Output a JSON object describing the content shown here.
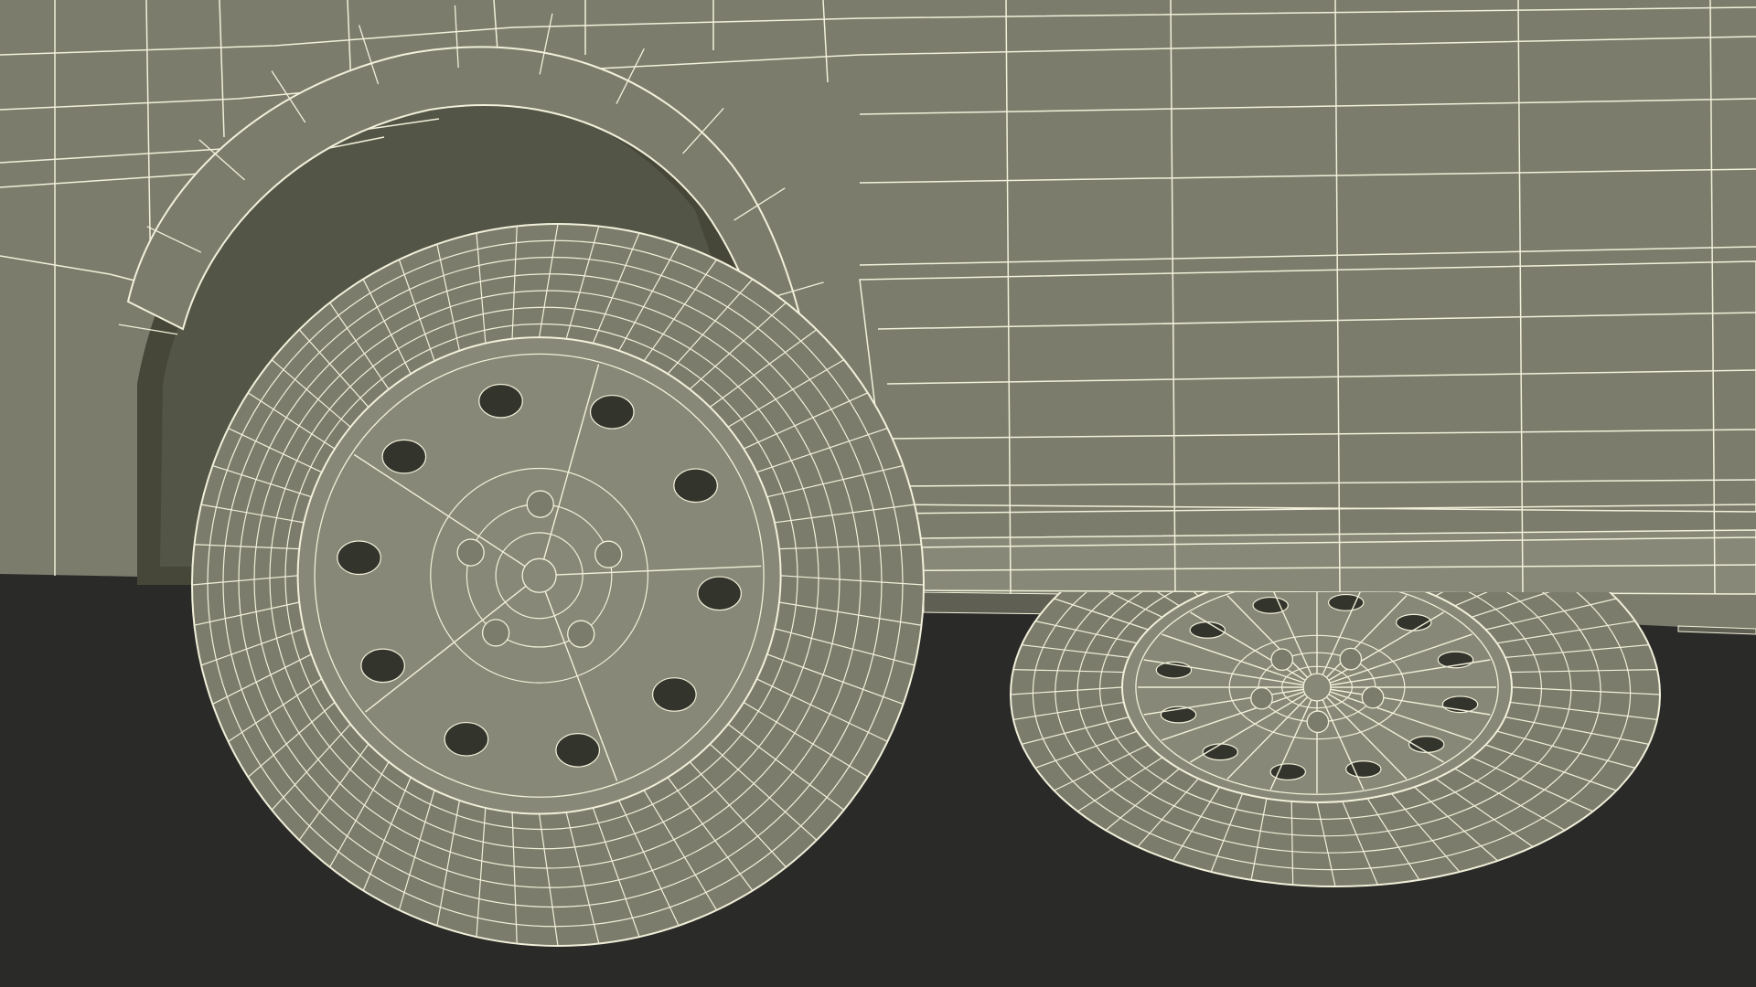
{
  "scene": {
    "subject": "car-wireframe-render",
    "colors": {
      "background": "#2a2a28",
      "surface": "#7b7c6c",
      "surface_dark": "#5f6053",
      "surface_light": "#878877",
      "wheel_well_inner": "#464739",
      "opening_dark": "#33342c",
      "wire": "#f2f0da"
    }
  }
}
